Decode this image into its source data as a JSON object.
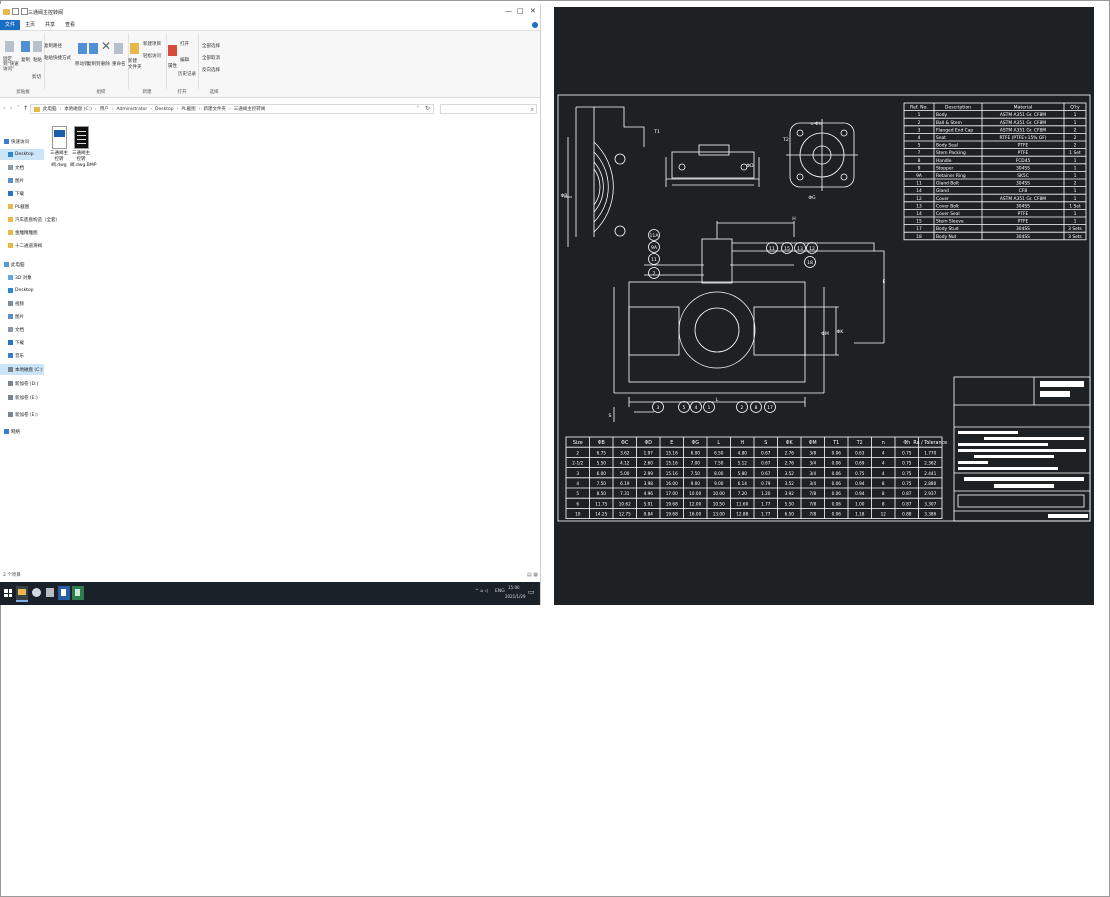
{
  "window": {
    "title": "三通阀主控转阀",
    "controls": {
      "minimize": "—",
      "maximize": "□",
      "close": "✕"
    }
  },
  "ribbon_tabs": [
    "文件",
    "主页",
    "共享",
    "查看"
  ],
  "ribbon": {
    "groups": [
      "剪贴板",
      "组织",
      "新建",
      "打开",
      "选择"
    ],
    "buttons": {
      "pin": "固定到\"快速访问\"",
      "copy": "复制",
      "paste": "粘贴",
      "copy_path": "复制路径",
      "paste_shortcut": "粘贴快捷方式",
      "cut": "剪切",
      "move_to": "移动到",
      "copy_to": "复制到",
      "delete": "删除",
      "rename": "重命名",
      "new_folder": "新建\n文件夹",
      "new_item": "新建项目",
      "easy_access": "轻松访问",
      "properties": "属性",
      "open": "打开",
      "edit": "编辑",
      "history": "历史记录",
      "select_all": "全部选择",
      "select_none": "全部取消",
      "invert_selection": "反向选择"
    }
  },
  "address": {
    "crumbs": [
      "此电脑",
      "本地磁盘 (C:)",
      "用户",
      "Administrator",
      "Desktop",
      "PL截图",
      "新建文件夹",
      "三通阀主控转阀"
    ]
  },
  "nav": {
    "items": [
      {
        "label": "快速访问",
        "icon": "star-icon"
      },
      {
        "label": "Desktop",
        "icon": "desktop-icon",
        "selected": true
      },
      {
        "label": "文档",
        "icon": "document-icon"
      },
      {
        "label": "图片",
        "icon": "picture-icon"
      },
      {
        "label": "下载",
        "icon": "download-icon"
      },
      {
        "label": "PL截图",
        "icon": "folder-icon"
      },
      {
        "label": "汽车底盘构造（全套）",
        "icon": "folder-icon"
      },
      {
        "label": "金雕精雕图",
        "icon": "folder-icon"
      },
      {
        "label": "十二通道滑阀",
        "icon": "folder-icon"
      },
      {
        "label": "此电脑",
        "icon": "computer-icon"
      },
      {
        "label": "3D 对象",
        "icon": "cube-icon"
      },
      {
        "label": "Desktop",
        "icon": "desktop-icon"
      },
      {
        "label": "视频",
        "icon": "video-icon"
      },
      {
        "label": "图片",
        "icon": "picture-icon"
      },
      {
        "label": "文档",
        "icon": "document-icon"
      },
      {
        "label": "下载",
        "icon": "download-icon"
      },
      {
        "label": "音乐",
        "icon": "music-icon"
      },
      {
        "label": "本地磁盘 (C:)",
        "icon": "drive-icon",
        "selected": true
      },
      {
        "label": "新加卷 (D:)",
        "icon": "drive-icon"
      },
      {
        "label": "新加卷 (E:)",
        "icon": "drive-icon"
      },
      {
        "label": "新加卷 (E:)",
        "icon": "drive-icon"
      },
      {
        "label": "网络",
        "icon": "network-icon"
      }
    ]
  },
  "files": [
    {
      "name": "三通阀主控转阀.dwg",
      "icon": "dwg-file-icon"
    },
    {
      "name": "三通阀主控转阀.dwg.BMP",
      "icon": "bmp-file-icon"
    }
  ],
  "statusbar": {
    "count": "2 个项目"
  },
  "taskbar": {
    "time": "15:00",
    "date": "2021/1/29",
    "lang": "ENG"
  },
  "cad": {
    "parts_header": [
      "Ref. No.",
      "Description",
      "Material",
      "Q'ty"
    ],
    "parts_rows": [
      [
        "1",
        "Body",
        "ASTM A351 Gr. CF8M",
        "1"
      ],
      [
        "2",
        "Ball & Stem",
        "ASTM A351 Gr. CF8M",
        "1"
      ],
      [
        "3",
        "Flanged End Cap",
        "ASTM A351 Gr. CF8M",
        "2"
      ],
      [
        "4",
        "Seat",
        "RTFE (PTFE+15% GF)",
        "2"
      ],
      [
        "5",
        "Body Seal",
        "PTFE",
        "2"
      ],
      [
        "7",
        "Stem Packing",
        "PTFE",
        "1 Set"
      ],
      [
        "8",
        "Handle",
        "FCD45",
        "1"
      ],
      [
        "9",
        "Stopper",
        "304SS",
        "1"
      ],
      [
        "9A",
        "Retainer Ring",
        "SK5C",
        "1"
      ],
      [
        "11",
        "Gland Bolt",
        "304SS",
        "2"
      ],
      [
        "14",
        "Gland",
        "CF8",
        "1"
      ],
      [
        "12",
        "Cover",
        "ASTM A351 Gr. CF8M",
        "1"
      ],
      [
        "13",
        "Cover Bolt",
        "304SS",
        "1 Set"
      ],
      [
        "14",
        "Cover Seal",
        "PTFE",
        "1"
      ],
      [
        "15",
        "Stem Sleeve",
        "PTFE",
        "1"
      ],
      [
        "17",
        "Body Stud",
        "304SS",
        "3 Sets"
      ],
      [
        "18",
        "Body Nut",
        "304SS",
        "3 Sets"
      ]
    ],
    "dim_header": [
      "Size",
      "ΦB",
      "ΦC",
      "ΦD",
      "E",
      "ΦG",
      "L",
      "H",
      "S",
      "ΦK",
      "ΦM",
      "T1",
      "T2",
      "n",
      "Φh",
      "Ra / Tolerance"
    ],
    "dim_rows": [
      [
        "2",
        "6.75",
        "3.62",
        "1.97",
        "15.16",
        "6.00",
        "6.50",
        "4.80",
        "0.67",
        "2.76",
        "3/8",
        "0.06",
        "0.63",
        "4",
        "0.75",
        "1.770"
      ],
      [
        "2-1/2",
        "5.50",
        "4.12",
        "2.60",
        "15.16",
        "7.00",
        "7.50",
        "5.12",
        "0.67",
        "2.76",
        "3/4",
        "0.06",
        "0.69",
        "4",
        "0.75",
        "2.362"
      ],
      [
        "3",
        "6.00",
        "5.00",
        "2.99",
        "15.16",
        "7.50",
        "8.00",
        "5.80",
        "0.67",
        "3.52",
        "3/4",
        "0.06",
        "0.75",
        "4",
        "0.75",
        "2.441"
      ],
      [
        "4",
        "7.50",
        "6.19",
        "3.98",
        "16.00",
        "9.00",
        "9.00",
        "6.14",
        "0.79",
        "3.52",
        "3/4",
        "0.06",
        "0.94",
        "8",
        "0.75",
        "2.880"
      ],
      [
        "5",
        "8.50",
        "7.31",
        "4.96",
        "17.00",
        "10.00",
        "10.00",
        "7.20",
        "1.20",
        "3.92",
        "7/8",
        "0.06",
        "0.94",
        "8",
        "0.87",
        "2.937"
      ],
      [
        "6",
        "11.75",
        "10.62",
        "5.91",
        "19.68",
        "12.00",
        "10.50",
        "11.60",
        "1.77",
        "5.50",
        "7/8",
        "0.06",
        "1.00",
        "8",
        "0.87",
        "3.307"
      ],
      [
        "10",
        "14.25",
        "12.75",
        "9.84",
        "19.68",
        "16.00",
        "13.00",
        "12.88",
        "1.77",
        "6.50",
        "7/8",
        "0.06",
        "1.18",
        "12",
        "0.88",
        "3.386"
      ]
    ],
    "balloons": [
      "11A",
      "9A",
      "11",
      "7",
      "11",
      "15",
      "13",
      "12",
      "18",
      "3",
      "5",
      "4",
      "1",
      "2",
      "8",
      "17"
    ],
    "dim_letters": [
      "L",
      "H",
      "E",
      "ΦM",
      "ΦK",
      "S",
      "ΦB",
      "ΦD",
      "T2",
      "ΦG",
      "n-Φh",
      "T1"
    ]
  }
}
